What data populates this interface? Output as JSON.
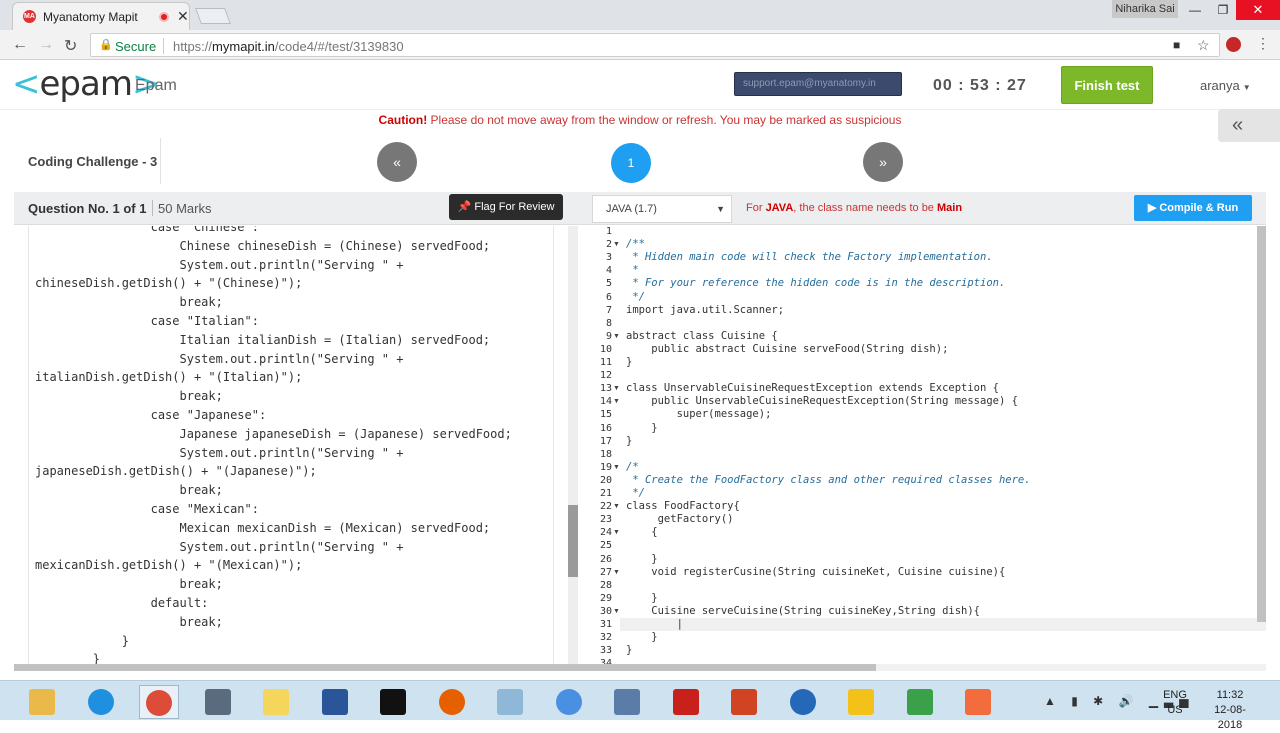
{
  "browser": {
    "tab_title": "Myanatomy Mapit",
    "tab_favicon": "MA",
    "window_user": "Niharika Sai",
    "secure_label": "Secure",
    "url_scheme": "https://",
    "url_host": "mymapit.in",
    "url_path": "/code4/#/test/3139830"
  },
  "header": {
    "logo_text": "epam",
    "company": "Epam",
    "support_email": "support.epam@myanatomy.in",
    "timer": "00 : 53 : 27",
    "finish_label": "Finish test",
    "user": "aranya"
  },
  "caution": {
    "bold": "Caution!",
    "text": " Please do not move away from the window or refresh. You may be marked as suspicious"
  },
  "nav": {
    "challenge": "Coding Challenge - 3",
    "prev": "«",
    "current": "1",
    "next": "»"
  },
  "question": {
    "number": "Question No. 1 of 1",
    "marks": "50 Marks",
    "flag_label": "Flag For Review",
    "code": "                case \"Chinese\":\n                    Chinese chineseDish = (Chinese) servedFood;\n                    System.out.println(\"Serving \" +\nchineseDish.getDish() + \"(Chinese)\");\n                    break;\n                case \"Italian\":\n                    Italian italianDish = (Italian) servedFood;\n                    System.out.println(\"Serving \" +\nitalianDish.getDish() + \"(Italian)\");\n                    break;\n                case \"Japanese\":\n                    Japanese japaneseDish = (Japanese) servedFood;\n                    System.out.println(\"Serving \" +\njapaneseDish.getDish() + \"(Japanese)\");\n                    break;\n                case \"Mexican\":\n                    Mexican mexicanDish = (Mexican) servedFood;\n                    System.out.println(\"Serving \" +\nmexicanDish.getDish() + \"(Mexican)\");\n                    break;\n                default:\n                    break;\n            }\n        }"
  },
  "editor": {
    "language": "JAVA (1.7)",
    "note_prefix": "For ",
    "note_lang": "JAVA",
    "note_mid": ", the class name needs to be ",
    "note_main": "Main",
    "compile_label": "Compile & Run",
    "lines": [
      {
        "n": "1",
        "t": "",
        "f": false
      },
      {
        "n": "2",
        "t": "/**",
        "f": true,
        "c": "cm"
      },
      {
        "n": "3",
        "t": " * Hidden main code will check the Factory implementation.",
        "f": false,
        "c": "cm"
      },
      {
        "n": "4",
        "t": " *",
        "f": false,
        "c": "cm"
      },
      {
        "n": "5",
        "t": " * For your reference the hidden code is in the description.",
        "f": false,
        "c": "cm"
      },
      {
        "n": "6",
        "t": " */",
        "f": false,
        "c": "cm"
      },
      {
        "n": "7",
        "t": "import java.util.Scanner;",
        "f": false
      },
      {
        "n": "8",
        "t": "",
        "f": false
      },
      {
        "n": "9",
        "t": "abstract class Cuisine {",
        "f": true
      },
      {
        "n": "10",
        "t": "    public abstract Cuisine serveFood(String dish);",
        "f": false
      },
      {
        "n": "11",
        "t": "}",
        "f": false
      },
      {
        "n": "12",
        "t": "",
        "f": false
      },
      {
        "n": "13",
        "t": "class UnservableCuisineRequestException extends Exception {",
        "f": true
      },
      {
        "n": "14",
        "t": "    public UnservableCuisineRequestException(String message) {",
        "f": true
      },
      {
        "n": "15",
        "t": "        super(message);",
        "f": false
      },
      {
        "n": "16",
        "t": "    }",
        "f": false
      },
      {
        "n": "17",
        "t": "}",
        "f": false
      },
      {
        "n": "18",
        "t": "",
        "f": false
      },
      {
        "n": "19",
        "t": "/*",
        "f": true,
        "c": "cm"
      },
      {
        "n": "20",
        "t": " * Create the FoodFactory class and other required classes here.",
        "f": false,
        "c": "cm"
      },
      {
        "n": "21",
        "t": " */",
        "f": false,
        "c": "cm"
      },
      {
        "n": "22",
        "t": "class FoodFactory{",
        "f": true
      },
      {
        "n": "23",
        "t": "     getFactory()",
        "f": false
      },
      {
        "n": "24",
        "t": "    {",
        "f": true
      },
      {
        "n": "25",
        "t": "",
        "f": false
      },
      {
        "n": "26",
        "t": "    }",
        "f": false
      },
      {
        "n": "27",
        "t": "    void registerCusine(String cuisineKet, Cuisine cuisine){",
        "f": true
      },
      {
        "n": "28",
        "t": "",
        "f": false
      },
      {
        "n": "29",
        "t": "    }",
        "f": false
      },
      {
        "n": "30",
        "t": "    Cuisine serveCuisine(String cuisineKey,String dish){",
        "f": true
      },
      {
        "n": "31",
        "t": "        |",
        "f": false
      },
      {
        "n": "32",
        "t": "    }",
        "f": false
      },
      {
        "n": "33",
        "t": "}",
        "f": false
      },
      {
        "n": "34",
        "t": "",
        "f": false
      }
    ]
  },
  "taskbar": {
    "icons": [
      "file-explorer-icon",
      "internet-explorer-icon",
      "chrome-icon",
      "sql-icon",
      "sticky-notes-icon",
      "word-icon",
      "cmd-icon",
      "firefox-icon",
      "notepad-icon",
      "chrome-canary-icon",
      "network-icon",
      "acrobat-icon",
      "powerpoint-icon",
      "r-icon",
      "python-icon",
      "winrar-icon",
      "screen-recorder-icon"
    ],
    "icon_colors": [
      "#e9b949",
      "#1f8fe0",
      "#dd4b39",
      "#5a6b7d",
      "#f3d65b",
      "#2a5699",
      "#111111",
      "#e66000",
      "#8fb7d8",
      "#4a90e2",
      "#5b7ca6",
      "#c8201a",
      "#d04423",
      "#2468b7",
      "#f2c21b",
      "#3aa14a",
      "#f26c3d"
    ],
    "lang": "ENG",
    "region": "US",
    "time": "11:32",
    "date": "12-08-2018"
  }
}
